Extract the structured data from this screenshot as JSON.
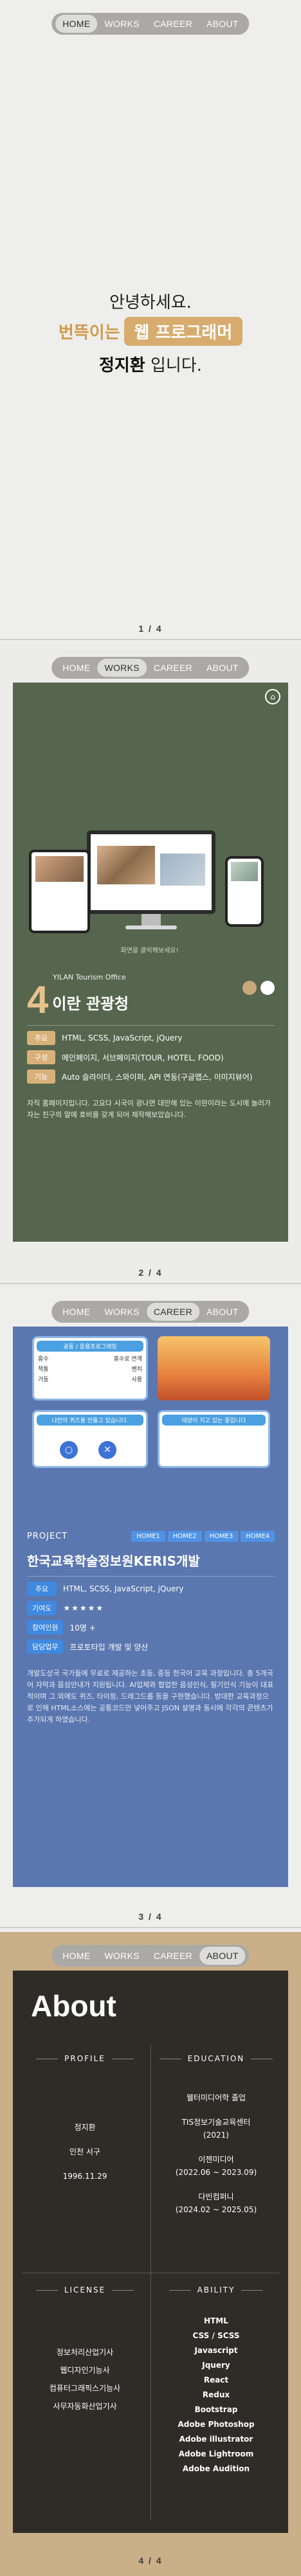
{
  "nav": {
    "items": [
      "HOME",
      "WORKS",
      "CAREER",
      "ABOUT"
    ]
  },
  "section1": {
    "greeting": "안녕하세요.",
    "name_prefix": "번뜩이는",
    "badge": "웹 프로그래머",
    "name": "정지환",
    "name_suffix": "입니다.",
    "pager": "1 / 4"
  },
  "section2": {
    "mock_caption": "화면을 클릭해보세요!",
    "subtitle": "YILAN Tourism Office",
    "number": "4",
    "title": "이란 관광청",
    "rows": [
      {
        "tag": "주요",
        "text": "HTML, SCSS, JavaScript, jQuery"
      },
      {
        "tag": "구성",
        "text": "메인페이지, 서브페이지(TOUR, HOTEL, FOOD)"
      },
      {
        "tag": "기능",
        "text": "Auto 슬라이더, 스와이퍼, API 연동(구글맵스, 이미지뷰어)"
      }
    ],
    "desc": "자직 홈페이지입니다. 고요다 시국이 광나면 대만해 있는 이란이라는 도시에 놀러가자는 친구의 말에 호비를 갖게 되어 제작해보았습니다.",
    "pager": "2 / 4",
    "colors": {
      "dot1": "#c9a77d",
      "dot2": "#ffffff"
    }
  },
  "section3": {
    "game": {
      "header1": "공동 / 응용프로그래밍",
      "header2": "응용 / 소수 문제",
      "row1": [
        "흥수",
        "흥수로 연계"
      ],
      "row2": [
        "책통",
        "벤치"
      ],
      "row3": [
        "가동",
        "사용"
      ],
      "pill": "나만의 퀴즈를 만들고 있습니다.",
      "right_header": "태양이 지고 있는 중입니다"
    },
    "label": "PROJECT",
    "homes": [
      "HOME1",
      "HOME2",
      "HOME3",
      "HOME4"
    ],
    "title": "한국교육학술정보원KERIS개발",
    "rows": [
      {
        "tag": "주요",
        "text": "HTML, SCSS, JavaScript, jQuery"
      },
      {
        "tag": "기여도",
        "text": "★★★★★"
      },
      {
        "tag": "참여인원",
        "text": "10명 +"
      },
      {
        "tag": "담당업무",
        "text": "프로토타입 개발 및 양산"
      }
    ],
    "desc": "개발도상국 국가들에 무료로 제공하는 초등, 중등 한국어 교육 과정입니다. 총 5개국어 자막과 음성안내가 지원됩니다. AI업체와 협업한 음성인식, 필기인식 기능이 대표적이며 그 외에도 퀴즈, 타이핑, 드래그드롭 등을 구현했습니다. 방대한 교육과정으로 인해 HTML소스에는 공통코드만 넣어주고 JSON 설명과 동시에 각각의 콘텐츠가 추가되게 하였습니다.",
    "pager": "3 / 4"
  },
  "section4": {
    "title": "About",
    "profile": {
      "title": "PROFILE",
      "lines": [
        "정지환",
        "인천 서구",
        "1996.11.29"
      ]
    },
    "education": {
      "title": "EDUCATION",
      "lines": [
        "웰터미디어학 졸업",
        "TIS정보기술교육센터",
        "(2021)",
        "이젠미디어",
        "(2022.06 ~ 2023.09)",
        "다빈컴퍼니",
        "(2024.02 ~ 2025.05)"
      ]
    },
    "license": {
      "title": "LICENSE",
      "lines": [
        "정보처리산업기사",
        "웹디자인기능사",
        "컴퓨터그래픽스기능사",
        "사무자동화산업기사"
      ]
    },
    "ability": {
      "title": "ABILITY",
      "lines": [
        "HTML",
        "CSS / SCSS",
        "Javascript",
        "Jquery",
        "React",
        "Redux",
        "Bootstrap",
        "Adobe Photoshop",
        "Adobe illustrator",
        "Adobe Lightroom",
        "Adobe Audition"
      ]
    },
    "pager": "4 / 4"
  }
}
